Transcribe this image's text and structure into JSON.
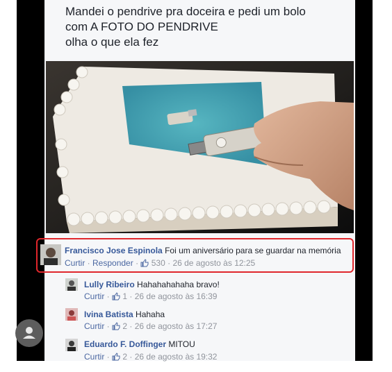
{
  "post": {
    "line1": "Mandei o pendrive pra doceira e pedi um bolo",
    "line2": "com A FOTO DO PENDRIVE",
    "line3": "olha o que ela fez"
  },
  "icons": {
    "like": "thumbs-up-icon",
    "profile": "user-icon"
  },
  "colors": {
    "name_link": "#365899",
    "highlight": "#e0262b",
    "meta": "#90949c"
  },
  "comments": [
    {
      "name": "Francisco Jose Espinola",
      "text": "Foi um aniversário para se guardar na memória",
      "like_label": "Curtir",
      "reply_label": "Responder",
      "likes": "530",
      "time": "26 de agosto às 12:25"
    },
    {
      "name": "Lully Ribeiro",
      "text": "Hahahahahaha bravo!",
      "like_label": "Curtir",
      "likes": "1",
      "time": "26 de agosto às 16:39"
    },
    {
      "name": "Ivina Batista",
      "text": "Hahaha",
      "like_label": "Curtir",
      "likes": "2",
      "time": "26 de agosto às 17:27"
    },
    {
      "name": "Eduardo F. Doffinger",
      "text": "MITOU",
      "like_label": "Curtir",
      "likes": "2",
      "time": "26 de agosto às 19:32"
    }
  ]
}
